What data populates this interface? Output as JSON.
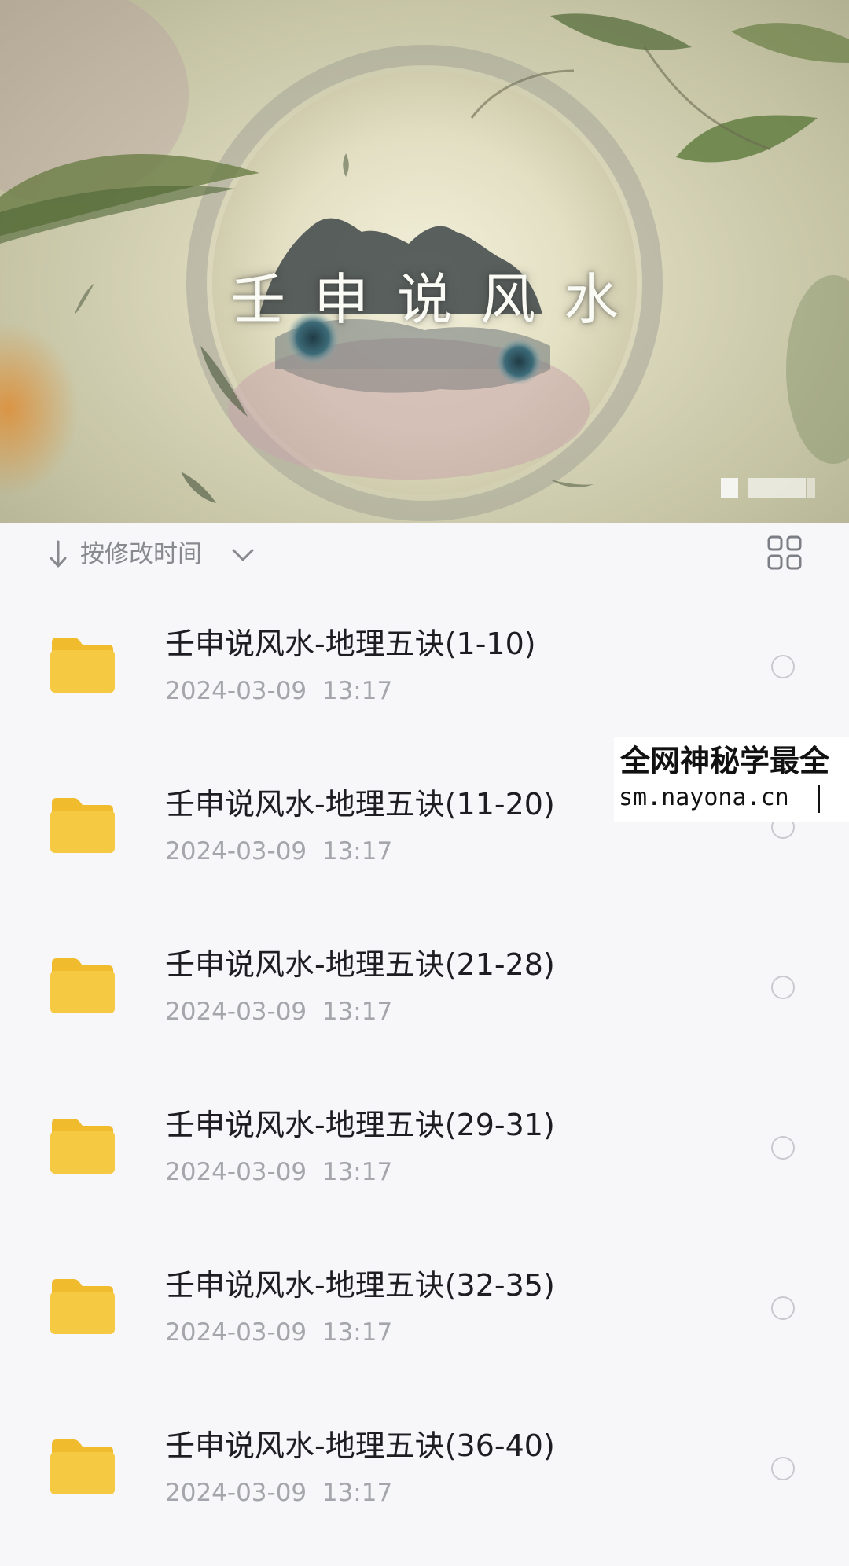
{
  "banner": {
    "title": "壬申说风水"
  },
  "sortbar": {
    "sort_label": "按修改时间",
    "arrow_icon": "down-arrow-icon",
    "chevron_icon": "chevron-down-icon",
    "view_toggle_icon": "grid-view-icon"
  },
  "files": [
    {
      "name": "壬申说风水-地理五诀(1-10)",
      "date": "2024-03-09  13:17"
    },
    {
      "name": "壬申说风水-地理五诀(11-20)",
      "date": "2024-03-09  13:17"
    },
    {
      "name": "壬申说风水-地理五诀(21-28)",
      "date": "2024-03-09  13:17"
    },
    {
      "name": "壬申说风水-地理五诀(29-31)",
      "date": "2024-03-09  13:17"
    },
    {
      "name": "壬申说风水-地理五诀(32-35)",
      "date": "2024-03-09  13:17"
    },
    {
      "name": "壬申说风水-地理五诀(36-40)",
      "date": "2024-03-09  13:17"
    }
  ],
  "overlay": {
    "line1": "全网神秘学最全",
    "line2": "sm.nayona.cn"
  },
  "colors": {
    "folder": "#f6c943",
    "folder_tab": "#f1bb2e",
    "background": "#f7f7f9",
    "text_primary": "#1d1d22",
    "text_secondary": "#a4a6ac"
  }
}
